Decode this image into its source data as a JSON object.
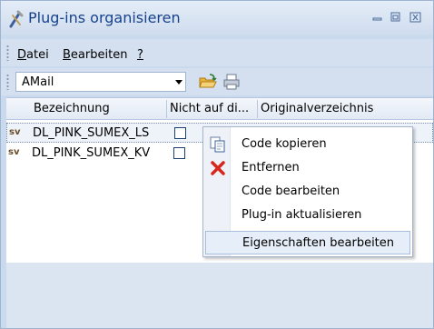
{
  "window": {
    "title": "Plug-ins organisieren",
    "minimize_icon": "minimize-icon",
    "restore_icon": "restore-icon",
    "close_icon": "close-icon"
  },
  "menubar": {
    "items": [
      {
        "label": "Datei",
        "mnemonic": "D"
      },
      {
        "label": "Bearbeiten",
        "mnemonic": "B"
      },
      {
        "label": "?",
        "mnemonic": "?"
      }
    ]
  },
  "toolbar": {
    "combo_value": "AMail",
    "open_icon": "folder-open-icon",
    "print_icon": "printer-icon"
  },
  "table": {
    "columns": [
      "Bezeichnung",
      "Nicht auf di...",
      "Originalverzeichnis"
    ],
    "rows": [
      {
        "icon": "sv-plugin-icon",
        "name": "DL_PINK_SUMEX_LS",
        "checked": false
      },
      {
        "icon": "sv-plugin-icon",
        "name": "DL_PINK_SUMEX_KV",
        "checked": false
      }
    ]
  },
  "context_menu": {
    "items": [
      {
        "label": "Code kopieren",
        "icon": "copy-icon"
      },
      {
        "label": "Entfernen",
        "icon": "delete-x-icon"
      },
      {
        "label": "Code bearbeiten",
        "icon": ""
      },
      {
        "label": "Plug-in aktualisieren",
        "icon": ""
      },
      {
        "label": "Eigenschaften bearbeiten",
        "icon": "",
        "highlighted": true
      }
    ]
  },
  "colors": {
    "title_text": "#15428b",
    "chrome": "#d4e0f0",
    "delete_red": "#d9261c"
  }
}
